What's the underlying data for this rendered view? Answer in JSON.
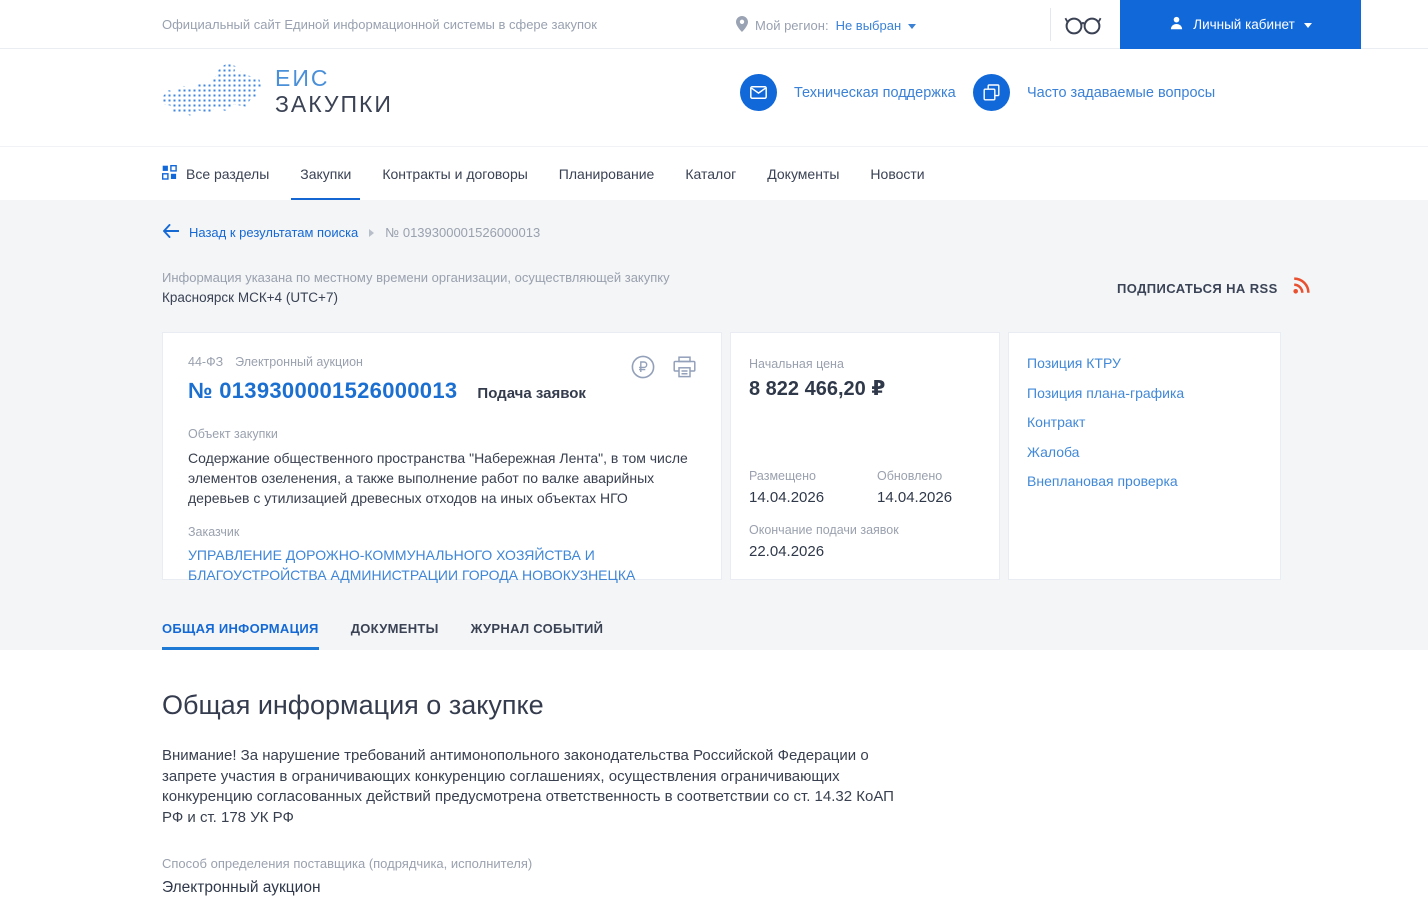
{
  "topbar": {
    "site_label": "Официальный сайт Единой информационной системы в сфере закупок",
    "region_label": "Мой регион:",
    "region_value": "Не выбран",
    "cabinet_label": "Личный кабинет"
  },
  "header": {
    "logo_line1": "ЕИС",
    "logo_line2": "ЗАКУПКИ",
    "support_label": "Техническая поддержка",
    "faq_label": "Часто задаваемые вопросы"
  },
  "nav": {
    "all_sections_label": "Все разделы",
    "items": [
      {
        "label": "Закупки",
        "active": true
      },
      {
        "label": "Контракты и договоры",
        "active": false
      },
      {
        "label": "Планирование",
        "active": false
      },
      {
        "label": "Каталог",
        "active": false
      },
      {
        "label": "Документы",
        "active": false
      },
      {
        "label": "Новости",
        "active": false
      }
    ]
  },
  "breadcrumb": {
    "back_label": "Назад к результатам поиска",
    "current": "№ 0139300001526000013"
  },
  "meta": {
    "timezone_note": "Информация указана по местному времени организации, осуществляющей закупку",
    "timezone_value": "Красноярск МСК+4 (UTC+7)",
    "rss_label": "ПОДПИСАТЬСЯ НА RSS"
  },
  "purchase": {
    "law_type": "44-ФЗ",
    "method_short": "Электронный аукцион",
    "number": "№ 0139300001526000013",
    "stage": "Подача заявок",
    "object_label": "Объект закупки",
    "object_text": "Содержание общественного пространства \"Набережная Лента\", в том числе элементов озеленения, а также выполнение работ по валке аварийных деревьев с утилизацией древесных отходов на иных объектах НГО",
    "customer_label": "Заказчик",
    "customer_name": "УПРАВЛЕНИЕ ДОРОЖНО-КОММУНАЛЬНОГО ХОЗЯЙСТВА И БЛАГОУСТРОЙСТВА АДМИНИСТРАЦИИ ГОРОДА НОВОКУЗНЕЦКА",
    "price_label": "Начальная цена",
    "price_value": "8 822 466,20 ₽",
    "placed_label": "Размещено",
    "placed_date": "14.04.2026",
    "updated_label": "Обновлено",
    "updated_date": "14.04.2026",
    "deadline_label": "Окончание подачи заявок",
    "deadline_date": "22.04.2026",
    "links": [
      "Позиция КТРУ",
      "Позиция плана-графика",
      "Контракт",
      "Жалоба",
      "Внеплановая проверка"
    ]
  },
  "tabs": [
    {
      "label": "ОБЩАЯ ИНФОРМАЦИЯ",
      "active": true
    },
    {
      "label": "ДОКУМЕНТЫ",
      "active": false
    },
    {
      "label": "ЖУРНАЛ СОБЫТИЙ",
      "active": false
    }
  ],
  "content": {
    "title": "Общая информация о закупке",
    "warning": "Внимание! За нарушение требований антимонопольного законодательства Российской Федерации о запрете участия в ограничивающих конкуренцию соглашениях, осуществления ограничивающих конкуренцию согласованных действий предусмотрена ответственность в соответствии со ст. 14.32 КоАП РФ и ст. 178 УК РФ",
    "method_label": "Способ определения поставщика (подрядчика, исполнителя)",
    "method_value": "Электронный аукцион"
  },
  "icons": {
    "location-pin-icon": "map pin glyph",
    "eyeglasses-icon": "accessibility glasses glyph",
    "user-icon": "person silhouette",
    "mail-icon": "envelope",
    "faq-icon": "overlapping chat squares",
    "sections-grid-icon": "four squares grid",
    "back-arrow-icon": "left arrow",
    "rss-icon": "rss waves",
    "ruble-circle-icon": "₽ in circle",
    "printer-icon": "printer",
    "chevron-down-icon": "▾"
  },
  "colors": {
    "accent_blue": "#1168d9",
    "link_blue": "#3b82d6",
    "rss_orange": "#e8502f",
    "band_gray": "#f3f5f7"
  }
}
